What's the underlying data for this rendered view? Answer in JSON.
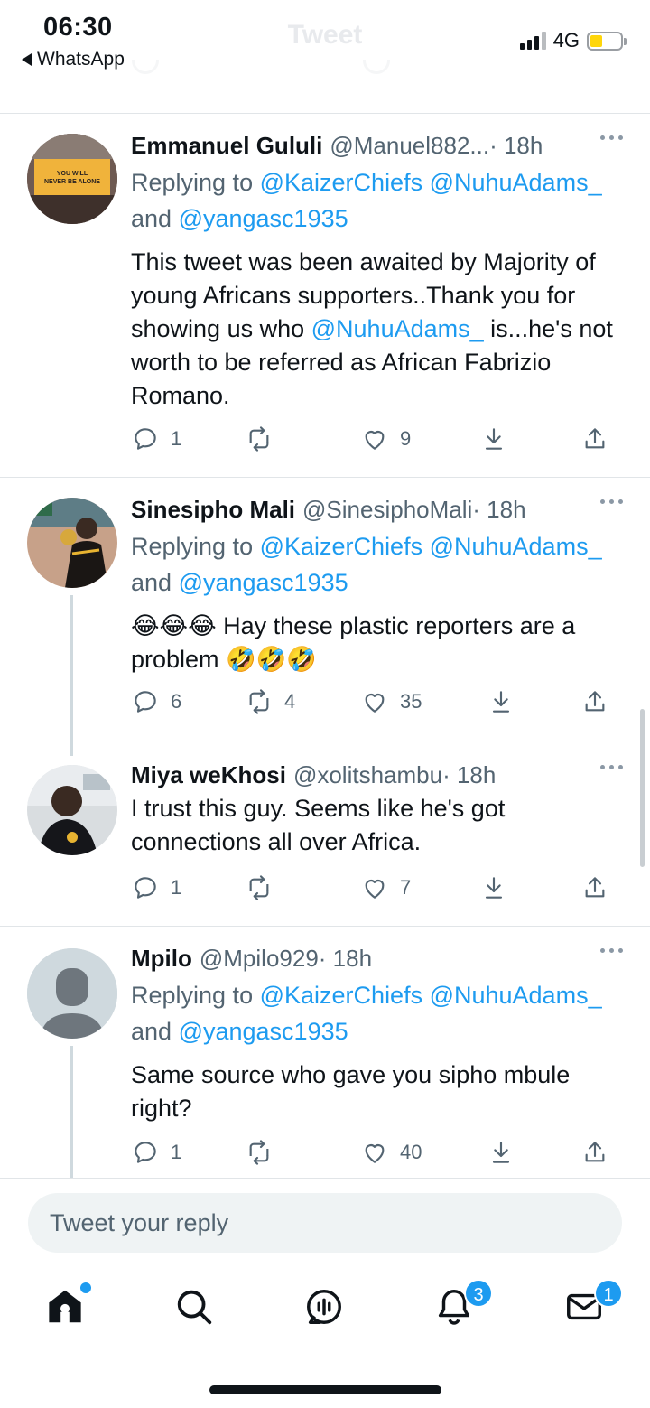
{
  "status_bar": {
    "time": "06:30",
    "back_app": "WhatsApp",
    "network": "4G",
    "header_title": "Tweet"
  },
  "tweets": [
    {
      "name": "Emmanuel Gululi",
      "handle": "@Manuel882...",
      "time": "· 18h",
      "replying_label": "Replying to",
      "mentions": "@KaizerChiefs @NuhuAdams_",
      "and_label": "and",
      "and_mention": "@yangasc1935",
      "text_before": "This tweet was been awaited by Majority of young Africans supporters..Thank you for showing us who ",
      "text_mention": "@NuhuAdams_",
      "text_after": " is...he's not worth to be referred as African Fabrizio Romano.",
      "avatar_text": "YOU WILL NEVER BE ALONE",
      "replies": "1",
      "retweets": "",
      "likes": "9"
    },
    {
      "name": "Sinesipho Mali",
      "handle": "@SinesiphoMali",
      "time": "· 18h",
      "replying_label": "Replying to",
      "mentions": "@KaizerChiefs @NuhuAdams_",
      "and_label": "and",
      "and_mention": "@yangasc1935",
      "text": "😂😂😂 Hay these plastic reporters are a problem 🤣🤣🤣",
      "replies": "6",
      "retweets": "4",
      "likes": "35"
    },
    {
      "name": "Miya weKhosi",
      "handle": "@xolitshambu",
      "time": "· 18h",
      "text": "I trust this guy. Seems like he's got connections all over Africa.",
      "replies": "1",
      "retweets": "",
      "likes": "7"
    },
    {
      "name": "Mpilo",
      "handle": "@Mpilo929",
      "time": "· 18h",
      "replying_label": "Replying to",
      "mentions": "@KaizerChiefs @NuhuAdams_",
      "and_label": "and",
      "and_mention": "@yangasc1935",
      "text": "Same source who gave you sipho mbule right?",
      "replies": "1",
      "retweets": "",
      "likes": "40"
    }
  ],
  "reply_bar": {
    "placeholder": "Tweet your reply"
  },
  "tab_bar": {
    "notifications_badge": "3",
    "messages_badge": "1"
  },
  "colors": {
    "accent": "#1d9bf0",
    "muted": "#536471",
    "text": "#0f1419"
  }
}
